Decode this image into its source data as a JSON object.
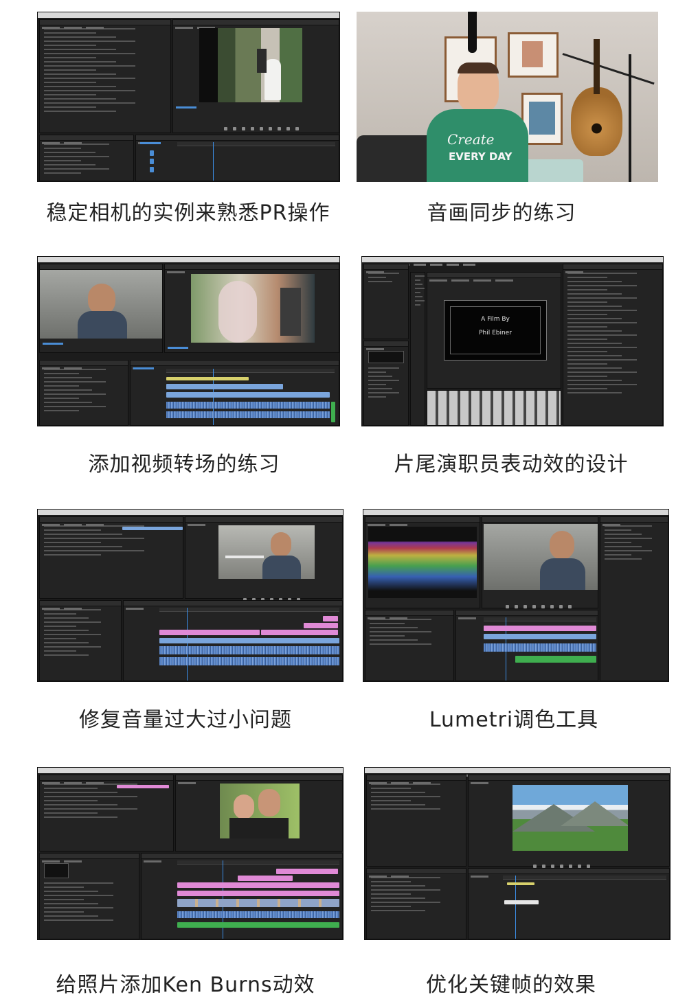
{
  "cards": [
    {
      "caption": "稳定相机的实例来熟悉PR操作",
      "kind": "premiere"
    },
    {
      "caption": "音画同步的练习",
      "kind": "video-photo"
    },
    {
      "caption": "添加视频转场的练习",
      "kind": "premiere"
    },
    {
      "caption": "片尾演职员表动效的设计",
      "kind": "premiere"
    },
    {
      "caption": "修复音量过大过小问题",
      "kind": "premiere"
    },
    {
      "caption": "Lumetri调色工具",
      "kind": "premiere"
    },
    {
      "caption": "给照片添加Ken Burns动效",
      "kind": "premiere"
    },
    {
      "caption": "优化关键帧的效果",
      "kind": "premiere"
    }
  ],
  "screen_text": {
    "shirt_line1": "Create",
    "shirt_line2": "EVERY DAY",
    "title_line1": "A Film By",
    "title_line2": "Phil Ebiner"
  },
  "colors": {
    "ui_bg": "#1c1c1c",
    "panel": "#232323",
    "accent_blue": "#4a8dd6",
    "clip_pink": "#e08ad6",
    "clip_blue": "#7aa5dc",
    "audio_green": "#3fae4f"
  }
}
